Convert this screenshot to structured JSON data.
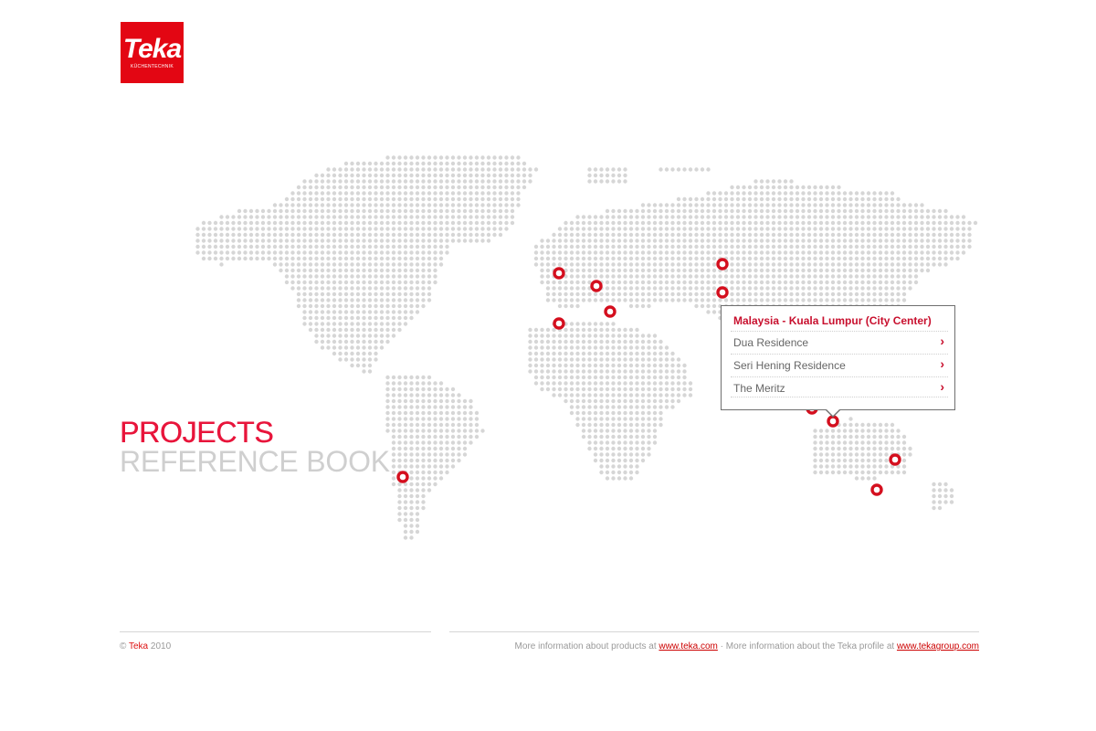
{
  "brand": {
    "logo_text": "Teka",
    "logo_subtext": "KÜCHENTECHNIK",
    "color": "#e30613"
  },
  "title": {
    "line1": "PROJECTS",
    "line2": "REFERENCE BOOK"
  },
  "popup": {
    "title": "Malaysia - Kuala Lumpur (City Center)",
    "items": [
      {
        "label": "Dua Residence"
      },
      {
        "label": "Seri Hening Residence"
      },
      {
        "label": "The Meritz"
      }
    ],
    "arrow_icon": "chevron-right-icon"
  },
  "map": {
    "dot_color": "#d6d6d6",
    "marker_color": "#d40f1e"
  },
  "footer": {
    "copyright_symbol": "©",
    "brand": "Teka",
    "year": "2010",
    "products_text": "More information about products at",
    "products_link": "www.teka.com",
    "separator": "·",
    "profile_text": "More information about the Teka profile at",
    "profile_link": "www.tekagroup.com"
  }
}
